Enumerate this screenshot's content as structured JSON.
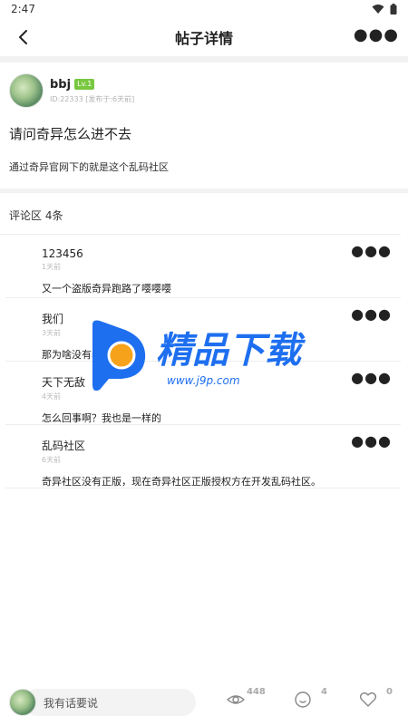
{
  "status_bar": {
    "time": "2:47"
  },
  "header": {
    "title": "帖子详情"
  },
  "post": {
    "author_name": "bbj",
    "level": "Lv.1",
    "meta": "ID:22333 [发布于:6天前]",
    "title": "请问奇异怎么进不去",
    "body": "通过奇异官网下的就是这个乱码社区"
  },
  "comments_section": {
    "header": "评论区 4条",
    "items": [
      {
        "name": "123456",
        "time": "1天前",
        "text": "又一个盗版奇异跑路了嘤嘤嘤"
      },
      {
        "name": "我们",
        "time": "3天前",
        "text": "那为啥没有老版本啊"
      },
      {
        "name": "天下无敌",
        "time": "4天前",
        "text": "怎么回事啊？我也是一样的"
      },
      {
        "name": "乱码社区",
        "time": "6天前",
        "text": "奇异社区没有正版，现在奇异社区正版授权方在开发乱码社区。"
      }
    ]
  },
  "watermark": {
    "title": "精品下载",
    "url": "www.j9p.com"
  },
  "bottom_bar": {
    "input_placeholder": "我有话要说",
    "views": "448",
    "comments": "4",
    "likes": "0"
  },
  "icons": {
    "back": "chevron-left-icon",
    "more": "more-dots-icon",
    "views": "eye-icon",
    "comments": "comment-bubble-icon",
    "likes": "heart-icon"
  },
  "colors": {
    "level_badge": "#78c840",
    "watermark_blue": "#1e6ff0",
    "watermark_orange": "#f7a21b"
  }
}
